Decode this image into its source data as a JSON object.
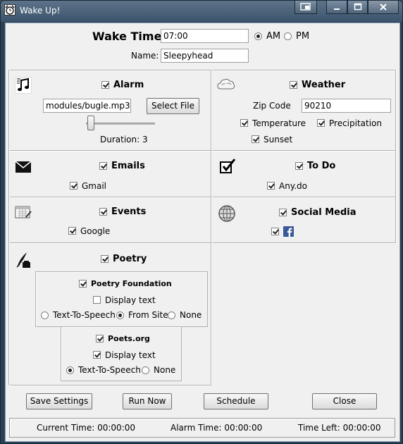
{
  "window": {
    "title": "Wake Up!"
  },
  "header": {
    "wake_time_label": "Wake Time:",
    "wake_time_value": "07:00",
    "am_label": "AM",
    "pm_label": "PM",
    "name_label": "Name:",
    "name_value": "Sleepyhead"
  },
  "alarm": {
    "label": "Alarm",
    "file_value": "modules/bugle.mp3",
    "select_file_label": "Select File",
    "duration_text": "Duration: 3",
    "duration_value": 3
  },
  "weather": {
    "label": "Weather",
    "zip_label": "Zip Code",
    "zip_value": "90210",
    "temperature_label": "Temperature",
    "precipitation_label": "Precipitation",
    "sunset_label": "Sunset"
  },
  "emails": {
    "label": "Emails",
    "gmail_label": "Gmail"
  },
  "todo": {
    "label": "To Do",
    "anydo_label": "Any.do"
  },
  "events": {
    "label": "Events",
    "google_label": "Google"
  },
  "social": {
    "label": "Social Media"
  },
  "poetry": {
    "label": "Poetry",
    "foundation": {
      "label": "Poetry Foundation",
      "display_text_label": "Display text",
      "tts_label": "Text-To-Speech",
      "from_site_label": "From Site",
      "none_label": "None"
    },
    "poets": {
      "label": "Poets.org",
      "display_text_label": "Display text",
      "tts_label": "Text-To-Speech",
      "none_label": "None"
    }
  },
  "buttons": {
    "save_label": "Save Settings",
    "run_label": "Run Now",
    "schedule_label": "Schedule",
    "close_label": "Close"
  },
  "status": {
    "current_time": "Current Time: 00:00:00",
    "alarm_time": "Alarm Time: 00:00:00",
    "time_left": "Time Left: 00:00:00"
  }
}
